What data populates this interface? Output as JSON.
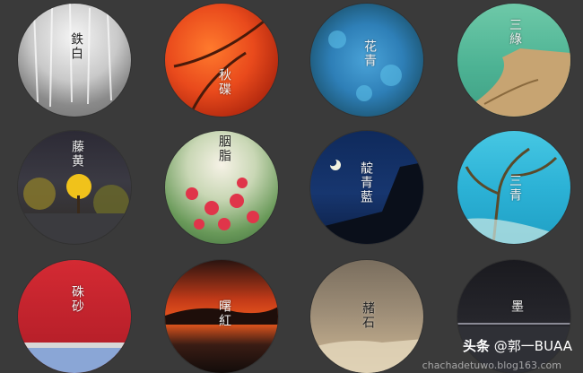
{
  "circles": [
    {
      "label": "鉄白"
    },
    {
      "label": "秋碟"
    },
    {
      "label": "花青"
    },
    {
      "label": "三綠"
    },
    {
      "label": "藤黄"
    },
    {
      "label": "胭脂"
    },
    {
      "label": "靛青藍"
    },
    {
      "label": "三青"
    },
    {
      "label": "硃砂"
    },
    {
      "label": "曙紅"
    },
    {
      "label": "赭石"
    },
    {
      "label": "墨"
    }
  ],
  "watermark": {
    "brand": "头条",
    "handle": "@郭一BUAA"
  },
  "faint_text": "chachadetuwo.blog163.com"
}
